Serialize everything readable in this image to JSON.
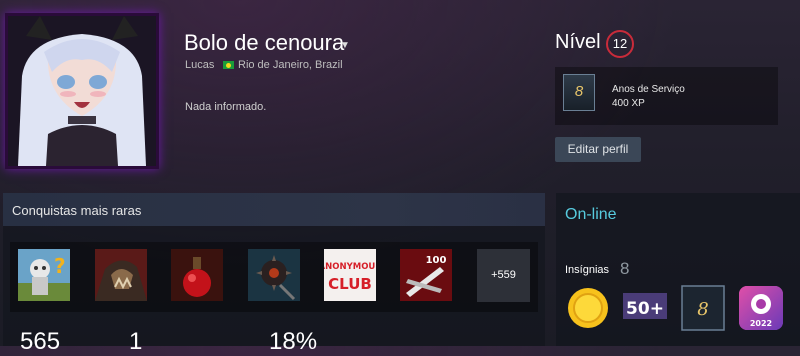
{
  "profile": {
    "persona_name": "Bolo de cenoura",
    "real_name": "Lucas",
    "location": "Rio de Janeiro, Brazil",
    "summary": "Nada informado."
  },
  "level": {
    "label": "Nível",
    "value": "12",
    "badge_title": "Anos de Serviço",
    "badge_xp": "400 XP",
    "badge_icon_digit": "8"
  },
  "edit_profile_label": "Editar perfil",
  "showcase": {
    "title": "Conquistas mais raras",
    "more_label": "+559",
    "achievements": [
      {
        "icon": "robot-question-icon"
      },
      {
        "icon": "monster-art-icon"
      },
      {
        "icon": "potion-icon"
      },
      {
        "icon": "spiked-bomb-icon"
      },
      {
        "icon": "anonymous-club-icon",
        "text": "ANONYMOUS CLUB"
      },
      {
        "icon": "blades-100-icon",
        "text": "100"
      }
    ],
    "stats": [
      "565",
      "1",
      "18%"
    ]
  },
  "status": {
    "online_label": "On-line"
  },
  "badges": {
    "label": "Insígnias",
    "count": "8",
    "items": [
      {
        "icon": "gold-coin-icon"
      },
      {
        "icon": "fifty-plus-icon",
        "text": "50+"
      },
      {
        "icon": "years-of-service-icon",
        "text": "8"
      },
      {
        "icon": "steam-2022-icon",
        "text": "2022"
      }
    ]
  },
  "colors": {
    "online": "#57cbde",
    "level_ring": "#c92b3a",
    "edit_button": "#3b4757",
    "avatar_glow": "#6a1aa5"
  }
}
